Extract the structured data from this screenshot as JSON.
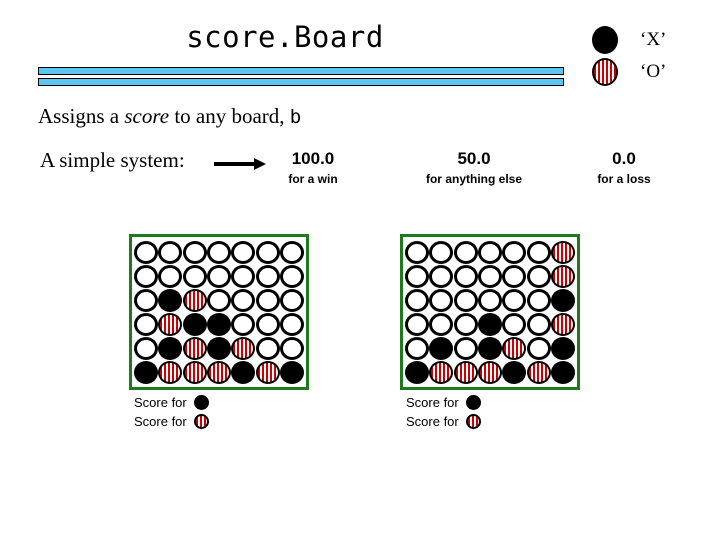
{
  "slide": {
    "title": "score.Board",
    "description_prefix": "Assigns a ",
    "description_italic": "score",
    "description_mid": " to any board, ",
    "description_mono": "b",
    "simple_label": "A simple system:",
    "arrow_icon": "right-arrow-icon"
  },
  "legend": {
    "items": [
      {
        "icon": "black-disc-icon",
        "label": "‘X’",
        "piece": "X"
      },
      {
        "icon": "striped-disc-icon",
        "label": "‘O’",
        "piece": "O"
      }
    ]
  },
  "scores": [
    {
      "value": "100.0",
      "caption": "for a win"
    },
    {
      "value": "50.0",
      "caption": "for anything else"
    },
    {
      "value": "0.0",
      "caption": "for a loss"
    }
  ],
  "colors": {
    "rule_blue": "#5BC6F0",
    "board_border_green": "#1E7A1E",
    "piece_x": "#000000",
    "piece_o_stripe": "#CC0000",
    "background": "#FFFFFF"
  },
  "boards": [
    {
      "name": "board-left",
      "rows": 6,
      "cols": 7,
      "grid": [
        [
          "",
          "",
          "",
          "",
          "",
          "",
          ""
        ],
        [
          "",
          "",
          "",
          "",
          "",
          "",
          ""
        ],
        [
          "",
          "X",
          "O",
          "",
          "",
          "",
          ""
        ],
        [
          "",
          "O",
          "X",
          "X",
          "",
          "",
          ""
        ],
        [
          "",
          "X",
          "O",
          "X",
          "O",
          "",
          ""
        ],
        [
          "X",
          "O",
          "O",
          "O",
          "X",
          "O",
          "X"
        ]
      ],
      "captions": [
        {
          "text": "Score for",
          "piece": "X"
        },
        {
          "text": "Score for",
          "piece": "O"
        }
      ]
    },
    {
      "name": "board-right",
      "rows": 6,
      "cols": 7,
      "grid": [
        [
          "",
          "",
          "",
          "",
          "",
          "",
          "O"
        ],
        [
          "",
          "",
          "",
          "",
          "",
          "",
          "O"
        ],
        [
          "",
          "",
          "",
          "",
          "",
          "",
          "X"
        ],
        [
          "",
          "",
          "",
          "X",
          "",
          "",
          "O"
        ],
        [
          "",
          "X",
          "",
          "X",
          "O",
          "",
          "X"
        ],
        [
          "X",
          "O",
          "O",
          "O",
          "X",
          "O",
          "X"
        ]
      ],
      "captions": [
        {
          "text": "Score for",
          "piece": "X"
        },
        {
          "text": "Score for",
          "piece": "O"
        }
      ]
    }
  ]
}
